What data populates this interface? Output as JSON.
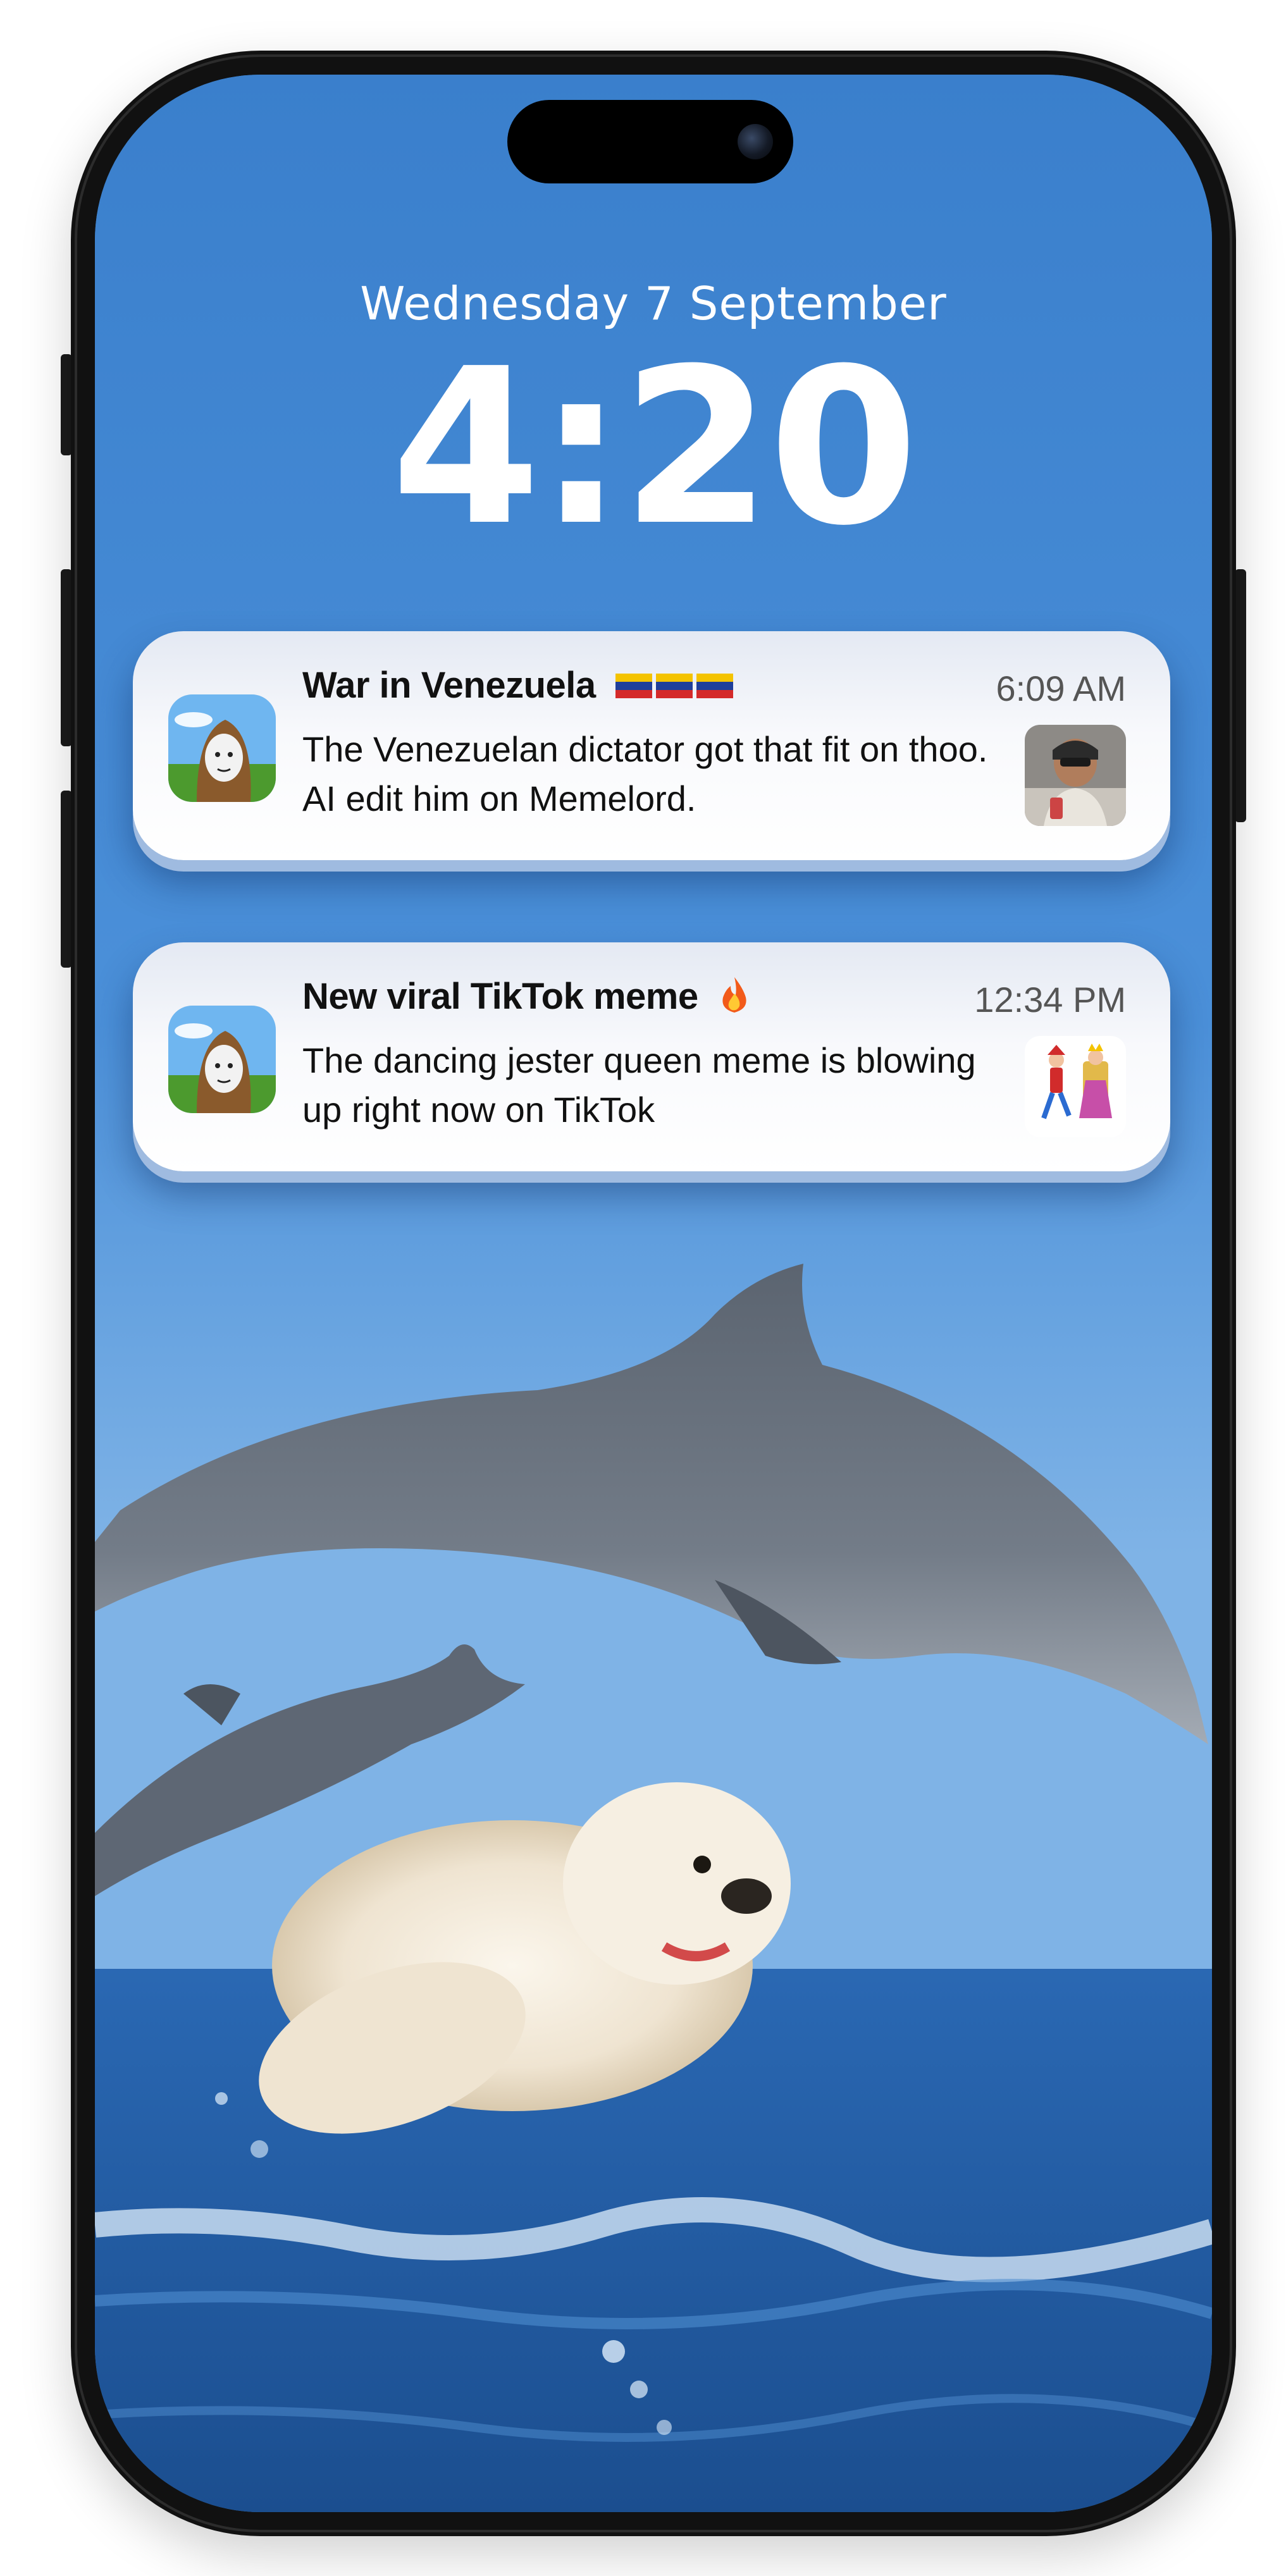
{
  "lockscreen": {
    "date": "Wednesday 7 September",
    "time": "4:20"
  },
  "notifications": [
    {
      "title": "War in Venezuela",
      "title_emoji": "venezuela-flags-icon",
      "time": "6:09 AM",
      "body": "The Venezuelan dictator got that fit on thoo. AI edit him on Memelord.",
      "app_icon": "memelord-app-icon",
      "thumbnail": "dictator-photo-thumbnail"
    },
    {
      "title": "New viral TikTok meme",
      "title_emoji": "fire-icon",
      "time": "12:34 PM",
      "body": "The dancing jester queen meme is blowing up right now on TikTok",
      "app_icon": "memelord-app-icon",
      "thumbnail": "jester-queen-thumbnail"
    }
  ],
  "colors": {
    "sky": "#3f86d1",
    "sea": "#1f5fa8",
    "notification_bg": "#ffffff"
  }
}
